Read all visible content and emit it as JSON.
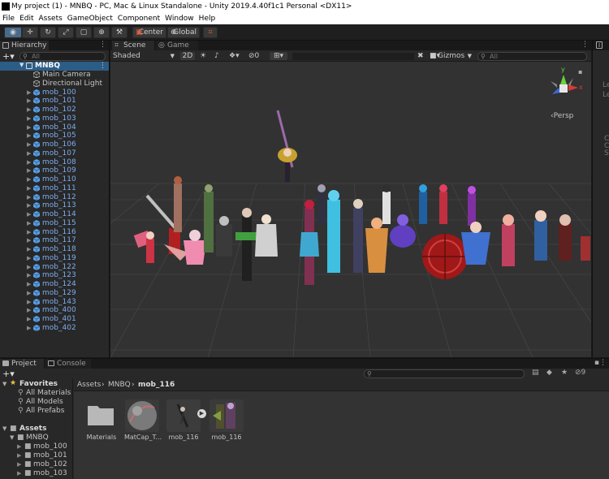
{
  "window": {
    "title": "My project (1) - MNBQ - PC, Mac & Linux Standalone - Unity 2019.4.40f1c1 Personal <DX11>"
  },
  "menu": [
    "File",
    "Edit",
    "Assets",
    "GameObject",
    "Component",
    "Window",
    "Help"
  ],
  "toolbar": {
    "pivot_label": "Center",
    "space_label": "Global"
  },
  "hierarchy": {
    "tab_label": "Hierarchy",
    "search_placeholder": "All",
    "scene_name": "MNBQ",
    "items": [
      {
        "label": "Main Camera",
        "prefab": false
      },
      {
        "label": "Directional Light",
        "prefab": false
      },
      {
        "label": "mob_100",
        "prefab": true
      },
      {
        "label": "mob_101",
        "prefab": true
      },
      {
        "label": "mob_102",
        "prefab": true
      },
      {
        "label": "mob_103",
        "prefab": true
      },
      {
        "label": "mob_104",
        "prefab": true
      },
      {
        "label": "mob_105",
        "prefab": true
      },
      {
        "label": "mob_106",
        "prefab": true
      },
      {
        "label": "mob_107",
        "prefab": true
      },
      {
        "label": "mob_108",
        "prefab": true
      },
      {
        "label": "mob_109",
        "prefab": true
      },
      {
        "label": "mob_110",
        "prefab": true
      },
      {
        "label": "mob_111",
        "prefab": true
      },
      {
        "label": "mob_112",
        "prefab": true
      },
      {
        "label": "mob_113",
        "prefab": true
      },
      {
        "label": "mob_114",
        "prefab": true
      },
      {
        "label": "mob_115",
        "prefab": true
      },
      {
        "label": "mob_116",
        "prefab": true
      },
      {
        "label": "mob_117",
        "prefab": true
      },
      {
        "label": "mob_118",
        "prefab": true
      },
      {
        "label": "mob_119",
        "prefab": true
      },
      {
        "label": "mob_122",
        "prefab": true
      },
      {
        "label": "mob_123",
        "prefab": true
      },
      {
        "label": "mob_124",
        "prefab": true
      },
      {
        "label": "mob_129",
        "prefab": true
      },
      {
        "label": "mob_143",
        "prefab": true
      },
      {
        "label": "mob_400",
        "prefab": true
      },
      {
        "label": "mob_401",
        "prefab": true
      },
      {
        "label": "mob_402",
        "prefab": true
      }
    ]
  },
  "scene": {
    "tab_scene": "Scene",
    "tab_game": "Game",
    "shading_mode": "Shaded",
    "mode_2d": "2D",
    "hidden_count": "0",
    "gizmos_label": "Gizmos",
    "search_placeholder": "All",
    "gizmo_y": "y",
    "gizmo_x": "x",
    "persp_label": "Persp"
  },
  "project": {
    "tab_project": "Project",
    "tab_console": "Console",
    "hidden_count": "9",
    "favorites_label": "Favorites",
    "favorites": [
      "All Materials",
      "All Models",
      "All Prefabs"
    ],
    "assets_label": "Assets",
    "tree": [
      "MNBQ",
      "mob_100",
      "mob_101",
      "mob_102",
      "mob_103"
    ],
    "breadcrumb": [
      "Assets",
      "MNBQ",
      "mob_116"
    ],
    "assets": [
      "Materials",
      "MatCap_T...",
      "mob_116",
      "mob_116"
    ]
  },
  "inspector": {
    "tab_glyph": "I",
    "side_letters": [
      "Le",
      "Le",
      "C",
      "C",
      "S"
    ]
  },
  "colors": {
    "prefab_text": "#7cacec",
    "selection": "#2c5d87",
    "panel": "#282828",
    "scene_bg": "#2b2b2b",
    "gizmo_x": "#d63a3a",
    "gizmo_y": "#6bd13c",
    "gizmo_z": "#3a6bd6"
  }
}
